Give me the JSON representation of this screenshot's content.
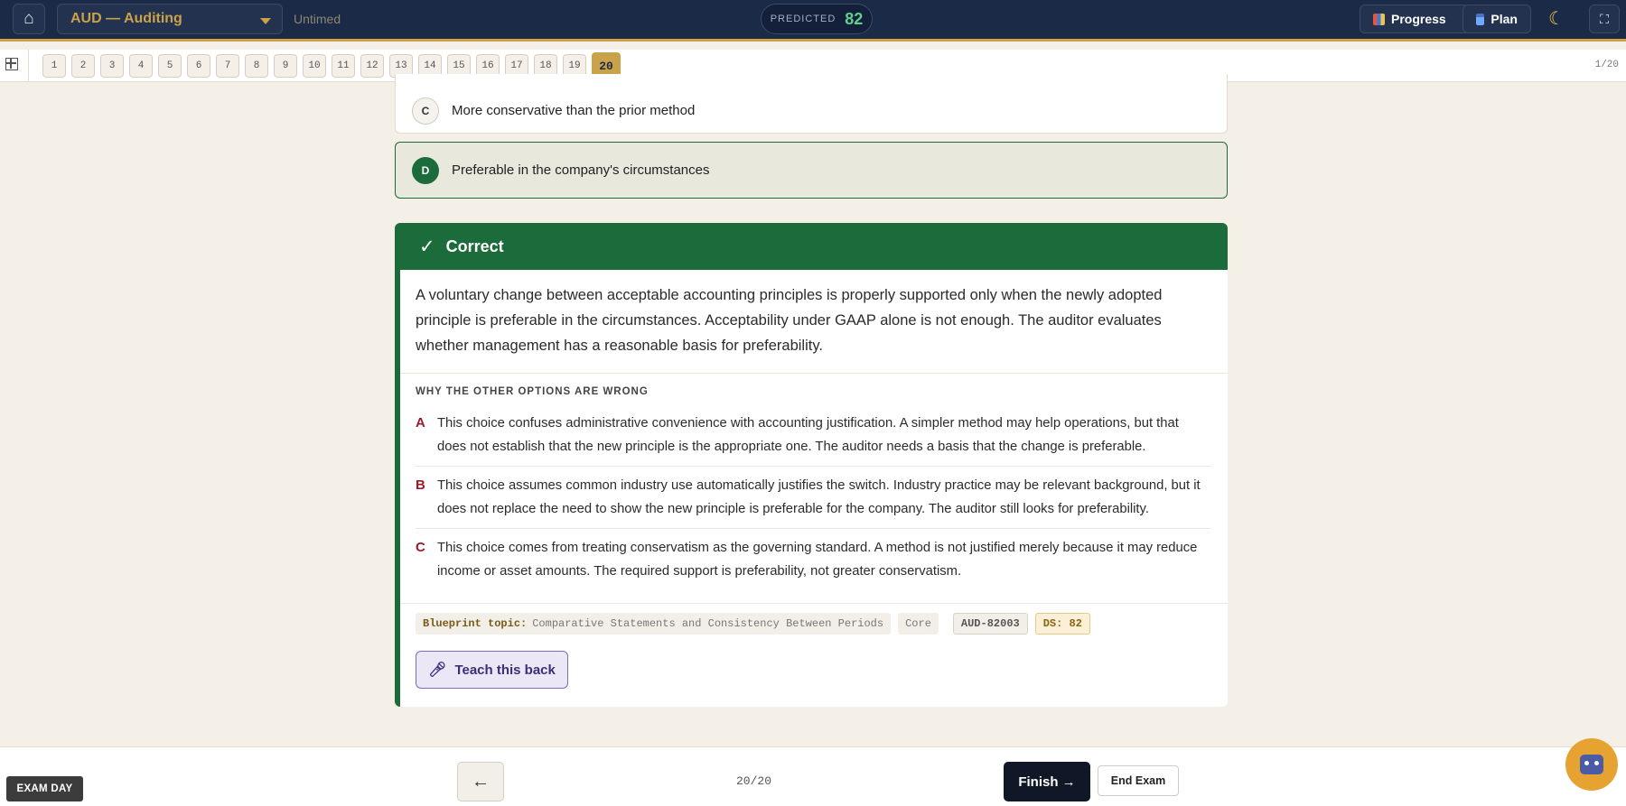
{
  "header": {
    "home_icon": "home-icon",
    "course": "AUD — Auditing",
    "timer_mode": "Untimed",
    "predicted_label": "PREDICTED",
    "predicted_value": "82",
    "progress_label": "Progress",
    "plan_label": "Plan",
    "theme_icon": "moon-icon",
    "fullscreen_icon": "fullscreen-icon"
  },
  "question_nav": {
    "items": [
      "1",
      "2",
      "3",
      "4",
      "5",
      "6",
      "7",
      "8",
      "9",
      "10",
      "11",
      "12",
      "13",
      "14",
      "15",
      "16",
      "17",
      "18",
      "19",
      "20"
    ],
    "current": "20",
    "counter": "1/20"
  },
  "options": [
    {
      "letter": "C",
      "text": "More conservative than the prior method"
    },
    {
      "letter": "D",
      "text": "Preferable in the company's circumstances"
    }
  ],
  "result": {
    "status": "Correct",
    "explanation": "A voluntary change between acceptable accounting principles is properly supported only when the newly adopted principle is preferable in the circumstances. Acceptability under GAAP alone is not enough. The auditor evaluates whether management has a reasonable basis for preferability.",
    "why_title": "WHY THE OTHER OPTIONS ARE WRONG",
    "wrong_options": [
      {
        "letter": "A",
        "text": "This choice confuses administrative convenience with accounting justification. A simpler method may help operations, but that does not establish that the new principle is the appropriate one. The auditor needs a basis that the change is preferable."
      },
      {
        "letter": "B",
        "text": "This choice assumes common industry use automatically justifies the switch. Industry practice may be relevant background, but it does not replace the need to show the new principle is preferable for the company. The auditor still looks for preferability."
      },
      {
        "letter": "C",
        "text": "This choice comes from treating conservatism as the governing standard. A method is not justified merely because it may reduce income or asset amounts. The required support is preferability, not greater conservatism."
      }
    ],
    "tags": {
      "blueprint_label": "Blueprint topic:",
      "blueprint_value": "Comparative Statements and Consistency Between Periods",
      "level": "Core",
      "id": "AUD-82003",
      "ds": "DS: 82"
    },
    "teach_label": "Teach this back"
  },
  "footer": {
    "exam_day": "EXAM DAY",
    "back_icon": "←",
    "page_counter": "20/20",
    "finish_label": "Finish →",
    "end_label": "End Exam"
  },
  "colors": {
    "navy": "#1b2a47",
    "gold": "#c9a24a",
    "correct_green": "#1c6b3a",
    "wrong_red": "#9a1b2b"
  }
}
